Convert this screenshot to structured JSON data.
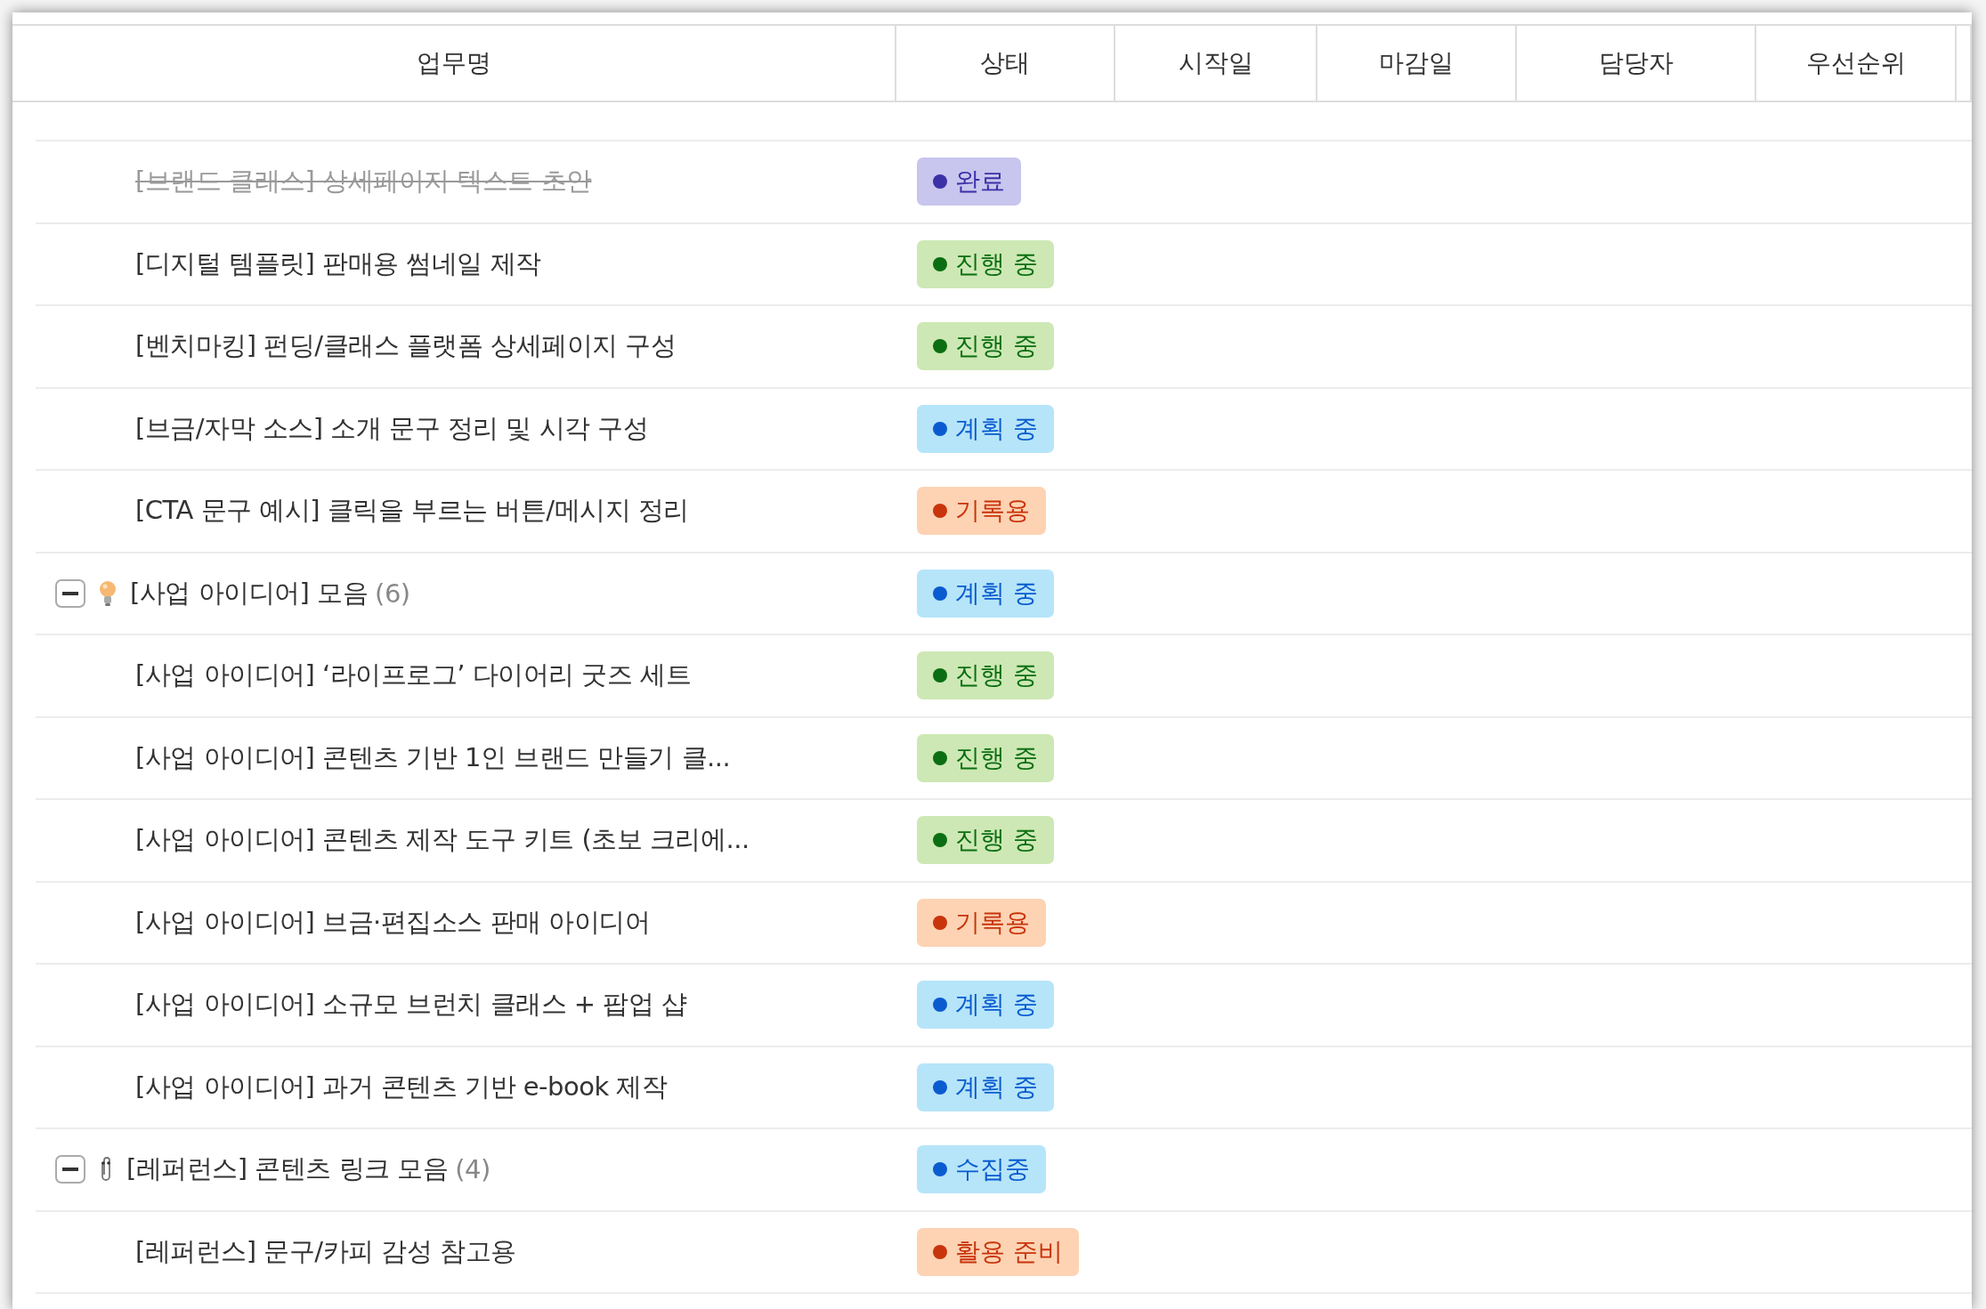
{
  "table": {
    "columns": [
      "업무명",
      "상태",
      "시작일",
      "마감일",
      "담당자",
      "우선순위"
    ],
    "rows": [
      {
        "kind": "task",
        "title": "[브랜드 클래스] 상세페이지 텍스트 초안",
        "done": true,
        "status": {
          "label": "완료",
          "color": "#3b30a6"
        }
      },
      {
        "kind": "task",
        "title": "[디지털 템플릿] 판매용 썸네일 제작",
        "done": false,
        "status": {
          "label": "진행 중",
          "color": "#0b6e12"
        }
      },
      {
        "kind": "task",
        "title": "[벤치마킹] 펀딩/클래스 플랫폼 상세페이지 구성",
        "done": false,
        "status": {
          "label": "진행 중",
          "color": "#0b6e12"
        }
      },
      {
        "kind": "task",
        "title": "[브금/자막 소스] 소개 문구 정리 및 시각 구성",
        "done": false,
        "status": {
          "label": "계획 중",
          "color": "#0a5bd0"
        }
      },
      {
        "kind": "task",
        "title": "[CTA 문구 예시] 클릭을 부르는 버튼/메시지 정리",
        "done": false,
        "status": {
          "label": "기록용",
          "color": "#c8340c"
        }
      },
      {
        "kind": "group",
        "title": "[사업 아이디어] 모음",
        "count": "(6)",
        "expanded": true,
        "status": {
          "label": "계획 중",
          "color": "#0a5bd0"
        }
      },
      {
        "kind": "task",
        "title": "[사업 아이디어] ‘라이프로그’ 다이어리 굿즈 세트",
        "done": false,
        "status": {
          "label": "진행 중",
          "color": "#0b6e12"
        }
      },
      {
        "kind": "task",
        "title": "[사업 아이디어] 콘텐츠 기반 1인 브랜드 만들기 클...",
        "done": false,
        "status": {
          "label": "진행 중",
          "color": "#0b6e12"
        }
      },
      {
        "kind": "task",
        "title": "[사업 아이디어] 콘텐츠 제작 도구 키트 (초보 크리에...",
        "done": false,
        "status": {
          "label": "진행 중",
          "color": "#0b6e12"
        }
      },
      {
        "kind": "task",
        "title": "[사업 아이디어] 브금·편집소스 판매 아이디어",
        "done": false,
        "status": {
          "label": "기록용",
          "color": "#c8340c"
        }
      },
      {
        "kind": "task",
        "title": "[사업 아이디어] 소규모 브런치 클래스 + 팝업 샵",
        "done": false,
        "status": {
          "label": "계획 중",
          "color": "#0a5bd0"
        }
      },
      {
        "kind": "task",
        "title": "[사업 아이디어] 과거 콘텐츠 기반 e-book 제작",
        "done": false,
        "status": {
          "label": "계획 중",
          "color": "#0a5bd0"
        }
      },
      {
        "kind": "group",
        "title": "[레퍼런스] 콘텐츠 링크 모음",
        "count": "(4)",
        "expanded": true,
        "status": {
          "label": "수집중",
          "color": "#0a5bd0"
        }
      },
      {
        "kind": "task",
        "title": "[레퍼런스] 문구/카피 감성 참고용",
        "done": false,
        "status": {
          "label": "활용 준비",
          "color": "#c8340c"
        }
      }
    ]
  }
}
